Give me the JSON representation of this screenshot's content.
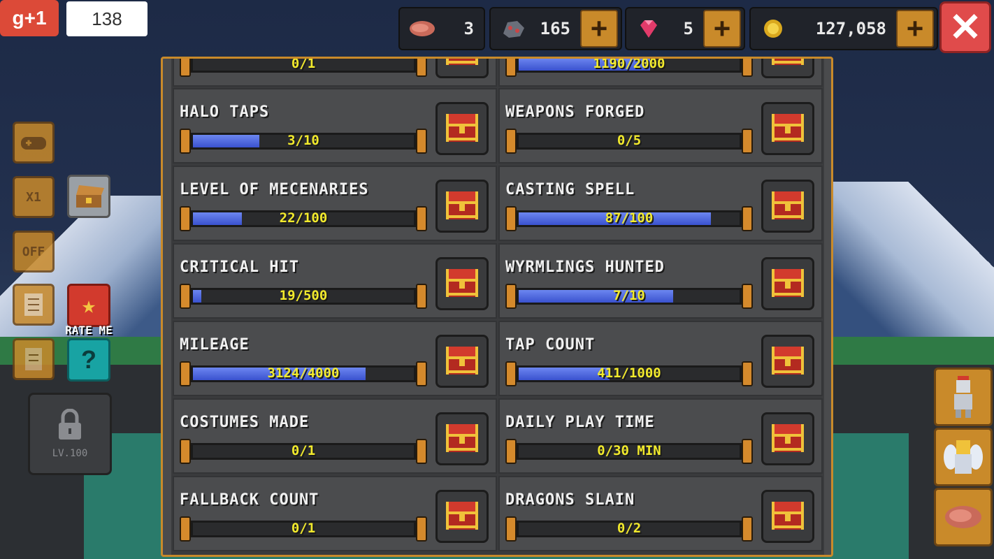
{
  "gplus": {
    "label": "g+1",
    "count": "138"
  },
  "resources": [
    {
      "name": "meat",
      "value": "3",
      "icon": "meat-icon"
    },
    {
      "name": "ore",
      "value": "165",
      "icon": "ore-icon"
    },
    {
      "name": "gem",
      "value": "5",
      "icon": "gem-icon"
    },
    {
      "name": "gold",
      "value": "127,058",
      "icon": "gold-coin-icon"
    }
  ],
  "plus_label": "+",
  "close_label": "✕",
  "side": {
    "speed_label": "X1",
    "off_label": "OFF",
    "rate_label": "RATE ME",
    "help_label": "?",
    "lock_label": "LV.100"
  },
  "top_partial": [
    {
      "progress": "0/1",
      "fraction": 0
    },
    {
      "progress": "1190/2000",
      "fraction": 0.595
    }
  ],
  "achievements": [
    {
      "title": "HALO TAPS",
      "progress": "3/10",
      "fraction": 0.3
    },
    {
      "title": "WEAPONS FORGED",
      "progress": "0/5",
      "fraction": 0
    },
    {
      "title": "LEVEL OF MECENARIES",
      "progress": "22/100",
      "fraction": 0.22
    },
    {
      "title": "CASTING SPELL",
      "progress": "87/100",
      "fraction": 0.87
    },
    {
      "title": "CRITICAL HIT",
      "progress": "19/500",
      "fraction": 0.038
    },
    {
      "title": "WYRMLINGS HUNTED",
      "progress": "7/10",
      "fraction": 0.7
    },
    {
      "title": "MILEAGE",
      "progress": "3124/4000",
      "fraction": 0.781
    },
    {
      "title": "TAP COUNT",
      "progress": "411/1000",
      "fraction": 0.411
    },
    {
      "title": "COSTUMES MADE",
      "progress": "0/1",
      "fraction": 0
    },
    {
      "title": "DAILY PLAY TIME",
      "progress": "0/30 MIN",
      "fraction": 0
    },
    {
      "title": "FALLBACK COUNT",
      "progress": "0/1",
      "fraction": 0
    },
    {
      "title": "DRAGONS SLAIN",
      "progress": "0/2",
      "fraction": 0
    }
  ],
  "colors": {
    "accent": "#c98a2a",
    "bar_fill": "#4a63e0",
    "progress_text": "#f2ea2c",
    "close": "#e04b4b"
  }
}
